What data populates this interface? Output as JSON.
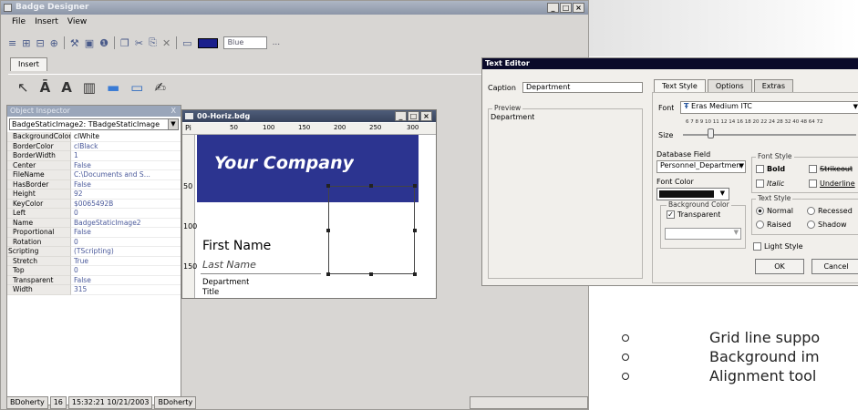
{
  "app": {
    "title": "Badge Designer"
  },
  "menu": [
    "File",
    "Insert",
    "View"
  ],
  "toolbar": {
    "color_name": "Blue",
    "more": "..."
  },
  "insert_tab": "Insert",
  "inspector": {
    "title": "Object Inspector",
    "close": "X",
    "combo": "BadgeStaticImage2: TBadgeStaticImage",
    "properties": [
      {
        "name": "BackgroundColor",
        "value": "clWhite"
      },
      {
        "name": "BorderColor",
        "value": "clBlack"
      },
      {
        "name": "BorderWidth",
        "value": "1"
      },
      {
        "name": "Center",
        "value": "False"
      },
      {
        "name": "FileName",
        "value": "C:\\Documents and S..."
      },
      {
        "name": "HasBorder",
        "value": "False"
      },
      {
        "name": "Height",
        "value": "92"
      },
      {
        "name": "KeyColor",
        "value": "$0065492B"
      },
      {
        "name": "Left",
        "value": "0"
      },
      {
        "name": "Name",
        "value": "BadgeStaticImage2"
      },
      {
        "name": "Proportional",
        "value": "False"
      },
      {
        "name": "Rotation",
        "value": "0"
      },
      {
        "name": "Scripting",
        "value": "(TScripting)"
      },
      {
        "name": "Stretch",
        "value": "True"
      },
      {
        "name": "Top",
        "value": "0"
      },
      {
        "name": "Transparent",
        "value": "False"
      },
      {
        "name": "Width",
        "value": "315"
      }
    ]
  },
  "status": {
    "user": "BDoherty",
    "count": "16",
    "datetime": "15:32:21 10/21/2003",
    "user2": "BDoherty"
  },
  "document": {
    "title": "00-Horiz.bdg",
    "ruler_corner": "Pi",
    "ruler_top": [
      "50",
      "100",
      "150",
      "200",
      "250",
      "300"
    ],
    "ruler_left": [
      "50",
      "100",
      "150"
    ],
    "company": "Your Company",
    "first_name": "First Name",
    "last_name": "Last Name",
    "department": "Department",
    "title_field": "Title"
  },
  "text_editor": {
    "title": "Text Editor",
    "caption_label": "Caption",
    "caption_value": "Department",
    "preview_label": "Preview",
    "preview_text": "Department",
    "tabs": [
      "Text Style",
      "Options",
      "Extras"
    ],
    "font_label": "Font",
    "font_value": "Eras Medium ITC",
    "size_label": "Size",
    "sizes": "6 7 8 9 10 11 12 14 16 18 20 22 24 28 32 40 48 64 72",
    "db_field_label": "Database Field",
    "db_field_value": "Personnel_Departmen",
    "font_color_label": "Font Color",
    "bg_color_label": "Background Color",
    "transparent_label": "Transparent",
    "font_style_label": "Font Style",
    "bold": "Bold",
    "strikeout": "Strikeout",
    "italic": "Italic",
    "underline": "Underline",
    "text_style_label": "Text Style",
    "normal": "Normal",
    "recessed": "Recessed",
    "raised": "Raised",
    "shadow": "Shadow",
    "light_style": "Light Style",
    "ok": "OK",
    "cancel": "Cancel"
  },
  "bullets": [
    "Grid line suppo",
    "Background im",
    "Alignment tool"
  ],
  "colors": {
    "banner": "#2c3490",
    "title_active": "#37435d"
  }
}
